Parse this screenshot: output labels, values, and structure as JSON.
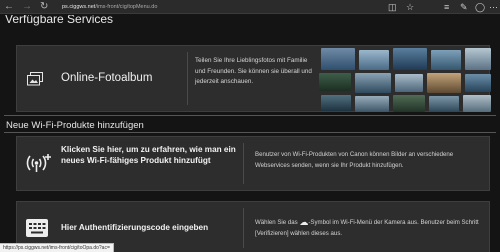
{
  "browser": {
    "url_host": "ps.ciggws.net",
    "url_path": "/ims-front/cig/topMenu.do"
  },
  "page": {
    "available_services_heading": "Verfügbare Services",
    "wifi_products_heading": "Neue Wi-Fi-Produkte hinzufügen"
  },
  "album_card": {
    "title": "Online-Fotoalbum",
    "description": "Teilen Sie Ihre Lieblingsfotos mit Familie und Freunden. Sie können sie überall und jederzeit anschauen."
  },
  "wifi_card": {
    "title": "Klicken Sie hier, um zu erfahren, wie man ein neues Wi-Fi-fähiges Produkt hinzufügt",
    "description": "Benutzer von Wi-Fi-Produkten von Canon können Bilder an verschiedene Webservices senden, wenn sie Ihr Produkt hinzufügen."
  },
  "auth_card": {
    "title": "Hier Authentifizierungscode eingeben",
    "desc_before": "Wählen Sie das",
    "desc_after": "-Symbol im Wi-Fi-Menü der Kamera aus. Benutzer beim Schritt [Verifizieren] wählen dieses aus."
  },
  "status_bar": {
    "url": "https://ps.ciggws.net/ims-front/cig/toOpa.do?ac="
  },
  "icons": {
    "back": "back-arrow-icon",
    "forward": "forward-arrow-icon",
    "reload": "reload-icon",
    "album": "photo-album-icon",
    "wifi_add": "wifi-add-icon",
    "keyboard": "keyboard-icon",
    "cloud": "cloud-icon"
  },
  "colors": {
    "page_bg": "#141414",
    "card_bg": "#2d2d2d",
    "chrome_bg": "#2b2b2b"
  }
}
